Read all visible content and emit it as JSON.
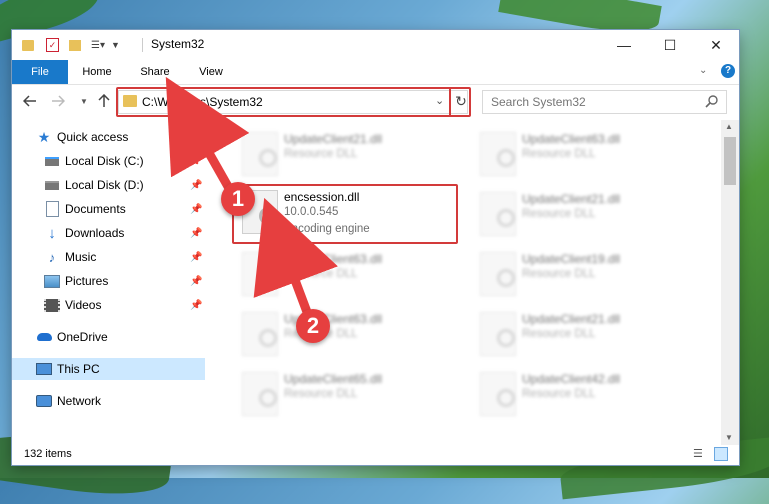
{
  "window": {
    "title": "System32",
    "controls": {
      "minimize": "—",
      "maximize": "☐",
      "close": "✕"
    }
  },
  "ribbon": {
    "tabs": [
      "File",
      "Home",
      "Share",
      "View"
    ]
  },
  "address": {
    "path": "C:\\Windows\\System32",
    "search_placeholder": "Search System32"
  },
  "sidebar": {
    "items": [
      {
        "label": "Quick access",
        "icon": "star-icon",
        "pinned": false
      },
      {
        "label": "Local Disk (C:)",
        "icon": "drive-icon",
        "pinned": true
      },
      {
        "label": "Local Disk (D:)",
        "icon": "drive-icon",
        "pinned": true
      },
      {
        "label": "Documents",
        "icon": "documents-icon",
        "pinned": true
      },
      {
        "label": "Downloads",
        "icon": "download-icon",
        "pinned": true
      },
      {
        "label": "Music",
        "icon": "music-icon",
        "pinned": true
      },
      {
        "label": "Pictures",
        "icon": "pictures-icon",
        "pinned": true
      },
      {
        "label": "Videos",
        "icon": "videos-icon",
        "pinned": true
      },
      {
        "label": "OneDrive",
        "icon": "cloud-icon",
        "pinned": false
      },
      {
        "label": "This PC",
        "icon": "computer-icon",
        "pinned": false,
        "selected": true
      },
      {
        "label": "Network",
        "icon": "network-icon",
        "pinned": false
      }
    ]
  },
  "files": {
    "highlighted": {
      "name": "encsession.dll",
      "version": "10.0.0.545",
      "description": "Encoding engine"
    },
    "left_column": [
      {
        "name": "UpdateClient21.dll",
        "type": "Resource DLL"
      },
      {
        "name": "UpdateClient63.dll",
        "type": "Resource DLL"
      },
      {
        "name": "UpdateClient63.dll",
        "type": "Resource DLL"
      },
      {
        "name": "UpdateClient65.dll",
        "type": "Resource DLL"
      }
    ],
    "right_column": [
      {
        "name": "UpdateClient63.dll",
        "type": "Resource DLL"
      },
      {
        "name": "UpdateClient21.dll",
        "type": "Resource DLL"
      },
      {
        "name": "UpdateClient19.dll",
        "type": "Resource DLL"
      },
      {
        "name": "UpdateClient21.dll",
        "type": "Resource DLL"
      },
      {
        "name": "UpdateClient42.dll",
        "type": "Resource DLL"
      }
    ]
  },
  "status": {
    "item_count": "132 items"
  },
  "annotations": {
    "step1": "1",
    "step2": "2"
  },
  "colors": {
    "accent": "#1979ca",
    "highlight": "#d33a3a",
    "selection": "#cce8ff"
  }
}
